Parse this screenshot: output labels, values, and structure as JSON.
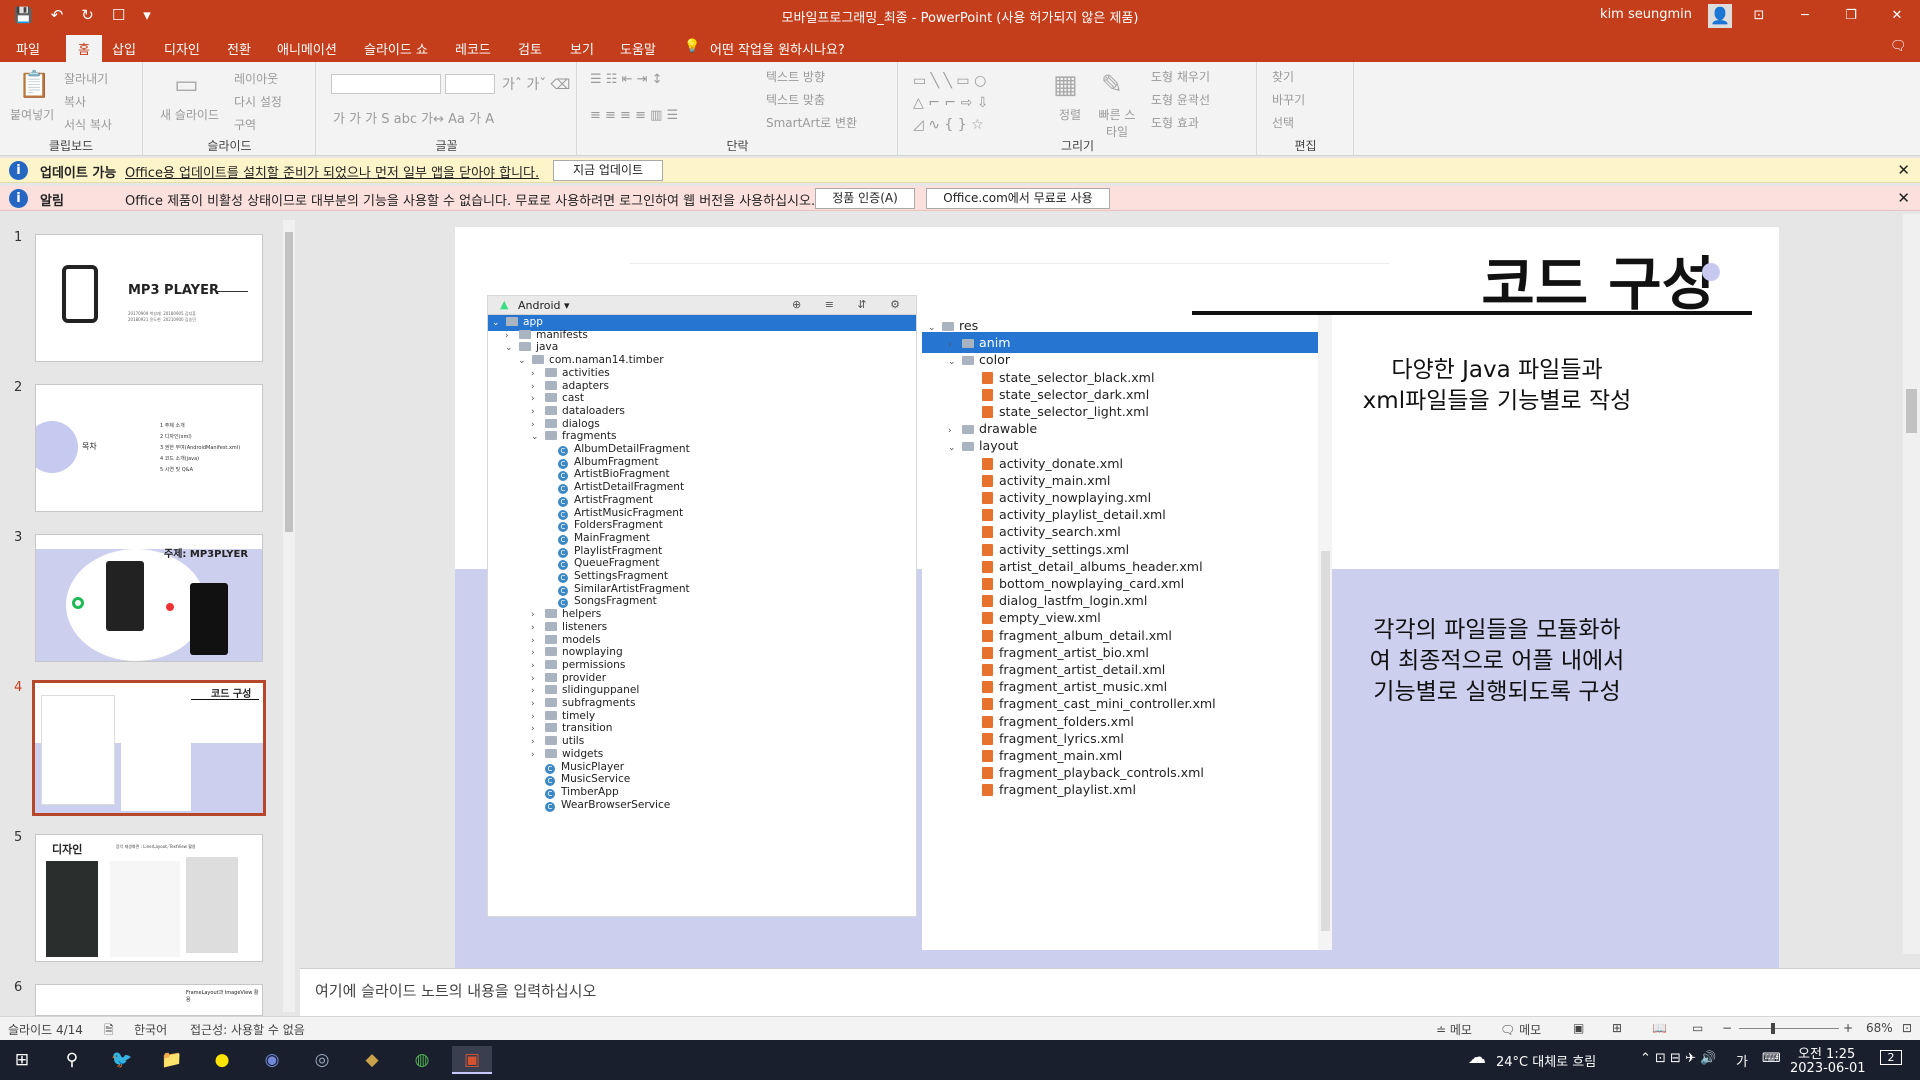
{
  "app": {
    "doc_title": "모바일프로그래밍_최종  -  PowerPoint (사용 허가되지 않은 제품)",
    "user_name": "kim seungmin",
    "window_controls": [
      "⊡",
      "─",
      "❐",
      "✕"
    ]
  },
  "qat": [
    "💾",
    "↶",
    "↻",
    "☐",
    "▾"
  ],
  "tabs": [
    {
      "label": "파일"
    },
    {
      "label": "홈"
    },
    {
      "label": "삽입"
    },
    {
      "label": "디자인"
    },
    {
      "label": "전환"
    },
    {
      "label": "애니메이션"
    },
    {
      "label": "슬라이드 쇼"
    },
    {
      "label": "레코드"
    },
    {
      "label": "검토"
    },
    {
      "label": "보기"
    },
    {
      "label": "도움말"
    }
  ],
  "tell_me": "어떤 작업을 원하시나요?",
  "ribbon": {
    "clipboard": {
      "label": "클립보드",
      "paste": "붙여넣기",
      "cut": "잘라내기",
      "copy": "복사",
      "format_painter": "서식 복사"
    },
    "slides": {
      "label": "슬라이드",
      "new_slide": "새 슬라이드",
      "layout": "레이아웃",
      "reset": "다시 설정",
      "section": "구역"
    },
    "font": {
      "label": "글꼴",
      "font_name": "",
      "font_size": ""
    },
    "paragraph": {
      "label": "단락",
      "text_direction": "텍스트 방향",
      "align_text": "텍스트 맞춤",
      "smartart": "SmartArt로 변환"
    },
    "drawing": {
      "label": "그리기",
      "arrange": "정렬",
      "quick_styles": "빠른 스타일",
      "shape_fill": "도형 채우기",
      "shape_outline": "도형 윤곽선",
      "shape_effects": "도형 효과"
    },
    "editing": {
      "label": "편집",
      "find": "찾기",
      "replace": "바꾸기",
      "select": "선택"
    }
  },
  "update_bar": {
    "title": "업데이트 가능",
    "message": "Office용 업데이트를 설치할 준비가 되었으나 먼저 일부 앱을 닫아야 합니다.",
    "button": "지금 업데이트"
  },
  "alert_bar": {
    "title": "알림",
    "message": "Office 제품이 비활성 상태이므로 대부분의 기능을 사용할 수 없습니다. 무료로 사용하려면 로그인하여 웹 버전을 사용하십시오.",
    "button_activate": "정품 인증(A)",
    "button_web": "Office.com에서 무료로 사용"
  },
  "thumbnails": [
    {
      "num": "1",
      "title": "MP3 PLAYER",
      "subtitle": "20170909 박성재  20180905 김지훈\n20180921 윤도현  20210900 김승민"
    },
    {
      "num": "2",
      "title": "목차",
      "items": [
        "1   주제 소개",
        "2   디자인(xml)",
        "3   권한 부여(AndroidManifest.xml)",
        "4   코드 소개(java)",
        "5   시연 및 Q&A"
      ]
    },
    {
      "num": "3",
      "title": "주제: MP3PLYER"
    },
    {
      "num": "4",
      "title": "코드 구성"
    },
    {
      "num": "5",
      "title": "디자인",
      "subtitle": "음악 재생화면 : LinerLayout, TextView 활용"
    },
    {
      "num": "6",
      "title": "FrameLayout과 ImageView 활용"
    }
  ],
  "slide": {
    "title": "코드 구성",
    "text1": "다양한 Java 파일들과\nxml파일들을 기능별로 작성",
    "text2": "각각의 파일들을 모듈화하\n여 최종적으로 어플 내에서\n기능별로 실행되도록 구성",
    "left_panel": {
      "header": "Android",
      "tools": "⊕ ≡ ⇵ ⚙",
      "rows": [
        {
          "level": 0,
          "chev": "⌄",
          "icon": "folder",
          "label": "app",
          "selected": true
        },
        {
          "level": 1,
          "chev": "›",
          "icon": "folder",
          "label": "manifests"
        },
        {
          "level": 1,
          "chev": "⌄",
          "icon": "folder",
          "label": "java"
        },
        {
          "level": 2,
          "chev": "⌄",
          "icon": "folder",
          "label": "com.naman14.timber"
        },
        {
          "level": 3,
          "chev": "›",
          "icon": "folder",
          "label": "activities"
        },
        {
          "level": 3,
          "chev": "›",
          "icon": "folder",
          "label": "adapters"
        },
        {
          "level": 3,
          "chev": "›",
          "icon": "folder",
          "label": "cast"
        },
        {
          "level": 3,
          "chev": "›",
          "icon": "folder",
          "label": "dataloaders"
        },
        {
          "level": 3,
          "chev": "›",
          "icon": "folder",
          "label": "dialogs"
        },
        {
          "level": 3,
          "chev": "⌄",
          "icon": "folder",
          "label": "fragments"
        },
        {
          "level": 4,
          "chev": "",
          "icon": "class",
          "label": "AlbumDetailFragment"
        },
        {
          "level": 4,
          "chev": "",
          "icon": "class",
          "label": "AlbumFragment"
        },
        {
          "level": 4,
          "chev": "",
          "icon": "class",
          "label": "ArtistBioFragment"
        },
        {
          "level": 4,
          "chev": "",
          "icon": "class",
          "label": "ArtistDetailFragment"
        },
        {
          "level": 4,
          "chev": "",
          "icon": "class",
          "label": "ArtistFragment"
        },
        {
          "level": 4,
          "chev": "",
          "icon": "class",
          "label": "ArtistMusicFragment"
        },
        {
          "level": 4,
          "chev": "",
          "icon": "class",
          "label": "FoldersFragment"
        },
        {
          "level": 4,
          "chev": "",
          "icon": "class",
          "label": "MainFragment"
        },
        {
          "level": 4,
          "chev": "",
          "icon": "class",
          "label": "PlaylistFragment"
        },
        {
          "level": 4,
          "chev": "",
          "icon": "class",
          "label": "QueueFragment"
        },
        {
          "level": 4,
          "chev": "",
          "icon": "class",
          "label": "SettingsFragment"
        },
        {
          "level": 4,
          "chev": "",
          "icon": "class",
          "label": "SimilarArtistFragment"
        },
        {
          "level": 4,
          "chev": "",
          "icon": "class",
          "label": "SongsFragment"
        },
        {
          "level": 3,
          "chev": "›",
          "icon": "folder",
          "label": "helpers"
        },
        {
          "level": 3,
          "chev": "›",
          "icon": "folder",
          "label": "listeners"
        },
        {
          "level": 3,
          "chev": "›",
          "icon": "folder",
          "label": "models"
        },
        {
          "level": 3,
          "chev": "›",
          "icon": "folder",
          "label": "nowplaying"
        },
        {
          "level": 3,
          "chev": "›",
          "icon": "folder",
          "label": "permissions"
        },
        {
          "level": 3,
          "chev": "›",
          "icon": "folder",
          "label": "provider"
        },
        {
          "level": 3,
          "chev": "›",
          "icon": "folder",
          "label": "slidinguppanel"
        },
        {
          "level": 3,
          "chev": "›",
          "icon": "folder",
          "label": "subfragments"
        },
        {
          "level": 3,
          "chev": "›",
          "icon": "folder",
          "label": "timely"
        },
        {
          "level": 3,
          "chev": "›",
          "icon": "folder",
          "label": "transition"
        },
        {
          "level": 3,
          "chev": "›",
          "icon": "folder",
          "label": "utils"
        },
        {
          "level": 3,
          "chev": "›",
          "icon": "folder",
          "label": "widgets"
        },
        {
          "level": 3,
          "chev": "",
          "icon": "class",
          "label": "MusicPlayer"
        },
        {
          "level": 3,
          "chev": "",
          "icon": "class",
          "label": "MusicService"
        },
        {
          "level": 3,
          "chev": "",
          "icon": "class",
          "label": "TimberApp"
        },
        {
          "level": 3,
          "chev": "",
          "icon": "class",
          "label": "WearBrowserService"
        }
      ]
    },
    "right_panel": {
      "rows": [
        {
          "level": 0,
          "chev": "⌄",
          "icon": "folder",
          "label": "res"
        },
        {
          "level": 1,
          "chev": "›",
          "icon": "folder",
          "label": "anim",
          "selected": true
        },
        {
          "level": 1,
          "chev": "⌄",
          "icon": "folder",
          "label": "color"
        },
        {
          "level": 2,
          "chev": "",
          "icon": "xml",
          "label": "state_selector_black.xml"
        },
        {
          "level": 2,
          "chev": "",
          "icon": "xml",
          "label": "state_selector_dark.xml"
        },
        {
          "level": 2,
          "chev": "",
          "icon": "xml",
          "label": "state_selector_light.xml"
        },
        {
          "level": 1,
          "chev": "›",
          "icon": "folder",
          "label": "drawable"
        },
        {
          "level": 1,
          "chev": "⌄",
          "icon": "folder",
          "label": "layout"
        },
        {
          "level": 2,
          "chev": "",
          "icon": "xml",
          "label": "activity_donate.xml"
        },
        {
          "level": 2,
          "chev": "",
          "icon": "xml",
          "label": "activity_main.xml"
        },
        {
          "level": 2,
          "chev": "",
          "icon": "xml",
          "label": "activity_nowplaying.xml"
        },
        {
          "level": 2,
          "chev": "",
          "icon": "xml",
          "label": "activity_playlist_detail.xml"
        },
        {
          "level": 2,
          "chev": "",
          "icon": "xml",
          "label": "activity_search.xml"
        },
        {
          "level": 2,
          "chev": "",
          "icon": "xml",
          "label": "activity_settings.xml"
        },
        {
          "level": 2,
          "chev": "",
          "icon": "xml",
          "label": "artist_detail_albums_header.xml"
        },
        {
          "level": 2,
          "chev": "",
          "icon": "xml",
          "label": "bottom_nowplaying_card.xml"
        },
        {
          "level": 2,
          "chev": "",
          "icon": "xml",
          "label": "dialog_lastfm_login.xml"
        },
        {
          "level": 2,
          "chev": "",
          "icon": "xml",
          "label": "empty_view.xml"
        },
        {
          "level": 2,
          "chev": "",
          "icon": "xml",
          "label": "fragment_album_detail.xml"
        },
        {
          "level": 2,
          "chev": "",
          "icon": "xml",
          "label": "fragment_artist_bio.xml"
        },
        {
          "level": 2,
          "chev": "",
          "icon": "xml",
          "label": "fragment_artist_detail.xml"
        },
        {
          "level": 2,
          "chev": "",
          "icon": "xml",
          "label": "fragment_artist_music.xml"
        },
        {
          "level": 2,
          "chev": "",
          "icon": "xml",
          "label": "fragment_cast_mini_controller.xml"
        },
        {
          "level": 2,
          "chev": "",
          "icon": "xml",
          "label": "fragment_folders.xml"
        },
        {
          "level": 2,
          "chev": "",
          "icon": "xml",
          "label": "fragment_lyrics.xml"
        },
        {
          "level": 2,
          "chev": "",
          "icon": "xml",
          "label": "fragment_main.xml"
        },
        {
          "level": 2,
          "chev": "",
          "icon": "xml",
          "label": "fragment_playback_controls.xml"
        },
        {
          "level": 2,
          "chev": "",
          "icon": "xml",
          "label": "fragment_playlist.xml"
        }
      ]
    }
  },
  "notes_placeholder": "여기에 슬라이드 노트의 내용을 입력하십시오",
  "status": {
    "slide_count": "슬라이드 4/14",
    "language": "한국어",
    "accessibility": "접근성: 사용할 수 없음",
    "notes": "≐ 메모",
    "comments": "메모",
    "zoom": "68%"
  },
  "taskbar": {
    "weather": "24°C  대체로 흐림",
    "ime": "가",
    "time": "오전 1:25",
    "date": "2023-06-01",
    "notif_count": "2"
  },
  "colors": {
    "accent": "#c43e1c",
    "selection": "#2675d1",
    "slide_band": "#cccfee"
  }
}
